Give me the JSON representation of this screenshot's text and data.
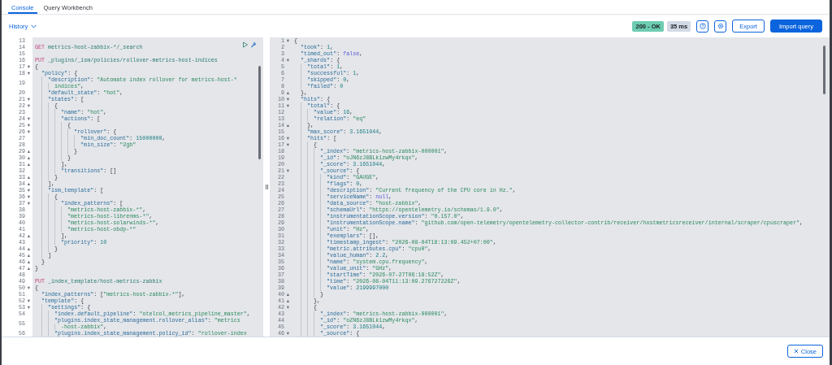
{
  "tabs": [
    {
      "label": "Console",
      "selected": true
    },
    {
      "label": "Query Workbench",
      "selected": false
    }
  ],
  "history": {
    "label": "History"
  },
  "status": {
    "code": "200 - OK",
    "time": "35 ms"
  },
  "toolbar_buttons": [
    {
      "label": "Export",
      "kind": "outline"
    },
    {
      "label": "Import query",
      "kind": "primary"
    }
  ],
  "request_editor": {
    "lines": [
      {
        "num": "13"
      },
      {
        "num": "14",
        "text": "GET metrics-host-zabbix-*/_search"
      },
      {
        "num": "15"
      },
      {
        "num": "16",
        "text": "PUT _plugins/_ism/policies/rollover-metrics-host-indices"
      },
      {
        "num": "17",
        "fold": "▾",
        "text": "{"
      },
      {
        "num": "18",
        "fold": "▾",
        "text": "  \"policy\": {"
      },
      {
        "num": "19",
        "text": "    \"description\": \"Automate index rollover for metrics-host-*",
        "wrap": "indices\","
      },
      {
        "num": "20",
        "text": "    \"default_state\": \"hot\","
      },
      {
        "num": "21",
        "fold": "▾",
        "text": "    \"states\": ["
      },
      {
        "num": "22",
        "fold": "▾",
        "text": "      {"
      },
      {
        "num": "23",
        "text": "        \"name\": \"hot\","
      },
      {
        "num": "24",
        "fold": "▾",
        "text": "        \"actions\": ["
      },
      {
        "num": "25",
        "fold": "▾",
        "text": "          {"
      },
      {
        "num": "26",
        "fold": "▾",
        "text": "            \"rollover\": {"
      },
      {
        "num": "27",
        "text": "              \"min_doc_count\": 15000000,"
      },
      {
        "num": "28",
        "text": "              \"min_size\": \"2gb\""
      },
      {
        "num": "29",
        "fold": "▴",
        "text": "            }"
      },
      {
        "num": "30",
        "fold": "▴",
        "text": "          }"
      },
      {
        "num": "31",
        "fold": "▴",
        "text": "        ],"
      },
      {
        "num": "32",
        "text": "        \"transitions\": []"
      },
      {
        "num": "33",
        "fold": "▴",
        "text": "      }"
      },
      {
        "num": "34",
        "fold": "▴",
        "text": "    ],"
      },
      {
        "num": "35",
        "fold": "▾",
        "text": "    \"ism_template\": ["
      },
      {
        "num": "36",
        "fold": "▾",
        "text": "      {"
      },
      {
        "num": "37",
        "fold": "▾",
        "text": "        \"index_patterns\": ["
      },
      {
        "num": "38",
        "text": "          \"metrics-host-zabbix-*\","
      },
      {
        "num": "39",
        "text": "          \"metrics-host-librenms-*\","
      },
      {
        "num": "40",
        "text": "          \"metrics-host-solarwinds-*\","
      },
      {
        "num": "41",
        "text": "          \"metrics-host-obdp-*\""
      },
      {
        "num": "42",
        "fold": "▴",
        "text": "        ],"
      },
      {
        "num": "43",
        "text": "        \"priority\": 10"
      },
      {
        "num": "44",
        "fold": "▴",
        "text": "      }"
      },
      {
        "num": "45",
        "fold": "▴",
        "text": "    ]"
      },
      {
        "num": "46",
        "fold": "▴",
        "text": "  }"
      },
      {
        "num": "47",
        "fold": "▴",
        "text": "}"
      },
      {
        "num": "48"
      },
      {
        "num": "49",
        "text": "PUT _index_template/host-metrics-zabbix"
      },
      {
        "num": "50",
        "fold": "▾",
        "text": "{"
      },
      {
        "num": "51",
        "text": "  \"index_patterns\": [\"metrics-host-zabbix-*\"],"
      },
      {
        "num": "52",
        "fold": "▾",
        "text": "  \"template\": {"
      },
      {
        "num": "53",
        "fold": "▾",
        "text": "    \"settings\": {"
      },
      {
        "num": "54",
        "text": "      \"index.default_pipeline\": \"otelcol_metrics_pipeline_master\","
      },
      {
        "num": "55",
        "text": "      \"plugins.index_state_management.rollover_alias\": \"metrics",
        "wrap": "-host-zabbix\","
      },
      {
        "num": "56",
        "text": "      \"plugins.index_state_management.policy_id\": \"rollover-index"
      }
    ]
  },
  "response_editor": {
    "lines": [
      {
        "num": "1",
        "fold": "▾",
        "text": "{"
      },
      {
        "num": "2",
        "text": "  \"took\": 1,"
      },
      {
        "num": "3",
        "text": "  \"timed_out\": false,"
      },
      {
        "num": "4",
        "fold": "▾",
        "text": "  \"_shards\": {"
      },
      {
        "num": "5",
        "text": "    \"total\": 1,"
      },
      {
        "num": "6",
        "text": "    \"successful\": 1,"
      },
      {
        "num": "7",
        "text": "    \"skipped\": 0,"
      },
      {
        "num": "8",
        "text": "    \"failed\": 0"
      },
      {
        "num": "9",
        "fold": "▴",
        "text": "  },"
      },
      {
        "num": "10",
        "fold": "▾",
        "text": "  \"hits\": {"
      },
      {
        "num": "11",
        "fold": "▾",
        "text": "    \"total\": {"
      },
      {
        "num": "12",
        "text": "      \"value\": 16,"
      },
      {
        "num": "13",
        "text": "      \"relation\": \"eq\""
      },
      {
        "num": "14",
        "fold": "▴",
        "text": "    },"
      },
      {
        "num": "15",
        "text": "    \"max_score\": 3.1651044,"
      },
      {
        "num": "16",
        "fold": "▾",
        "text": "    \"hits\": ["
      },
      {
        "num": "17",
        "fold": "▾",
        "text": "      {"
      },
      {
        "num": "18",
        "text": "        \"_index\": \"metrics-host-zabbix-000001\","
      },
      {
        "num": "19",
        "text": "        \"_id\": \"oJN6zJ8BLk1zwMy4rkqx\","
      },
      {
        "num": "20",
        "text": "        \"_score\": 3.1651044,"
      },
      {
        "num": "21",
        "fold": "▾",
        "text": "        \"_source\": {"
      },
      {
        "num": "22",
        "text": "          \"kind\": \"GAUGE\","
      },
      {
        "num": "23",
        "text": "          \"flags\": 0,"
      },
      {
        "num": "24",
        "text": "          \"description\": \"Current frequency of the CPU core in Hz.\","
      },
      {
        "num": "25",
        "text": "          \"serviceName\": null,"
      },
      {
        "num": "26",
        "text": "          \"data_source\": \"host-zabbix\","
      },
      {
        "num": "27",
        "text": "          \"schemaUrl\": \"https://opentelemetry.io/schemas/1.9.0\","
      },
      {
        "num": "28",
        "text": "          \"instrumentationScope.version\": \"0.157.0\","
      },
      {
        "num": "29",
        "text": "          \"instrumentationScope.name\": \"github.com/open-telemetry/opentelemetry-collector-contrib/receiver/hostmetricsreceiver/internal/scraper/cpuscraper\","
      },
      {
        "num": "30",
        "text": "          \"unit\": \"Hz\","
      },
      {
        "num": "31",
        "text": "          \"exemplars\": [],"
      },
      {
        "num": "32",
        "text": "          \"timestamp_ingest\": \"2026-08-04T18:13:09.452+07:00\","
      },
      {
        "num": "33",
        "text": "          \"metric.attributes.cpu\": \"cpu0\","
      },
      {
        "num": "34",
        "text": "          \"value_human\": 2.2,"
      },
      {
        "num": "35",
        "text": "          \"name\": \"system.cpu.frequency\","
      },
      {
        "num": "36",
        "text": "          \"value_unit\": \"GHz\","
      },
      {
        "num": "37",
        "text": "          \"startTime\": \"2026-07-27T06:18:52Z\","
      },
      {
        "num": "38",
        "text": "          \"time\": \"2026-08-04T11:13:09.276727226Z\","
      },
      {
        "num": "39",
        "text": "          \"value\": 2199997000"
      },
      {
        "num": "40",
        "fold": "▴",
        "text": "        }"
      },
      {
        "num": "41",
        "fold": "▴",
        "text": "      },"
      },
      {
        "num": "42",
        "fold": "▾",
        "text": "      {"
      },
      {
        "num": "43",
        "text": "        \"_index\": \"metrics-host-zabbix-000001\","
      },
      {
        "num": "44",
        "text": "        \"_id\": \"oZN6zJ8BLk1zwMy4rkqx\","
      },
      {
        "num": "45",
        "text": "        \"_score\": 3.1651044,"
      },
      {
        "num": "46",
        "fold": "▾",
        "text": "        \"_source\": {"
      }
    ]
  },
  "footer": {
    "close_label": "Close"
  }
}
